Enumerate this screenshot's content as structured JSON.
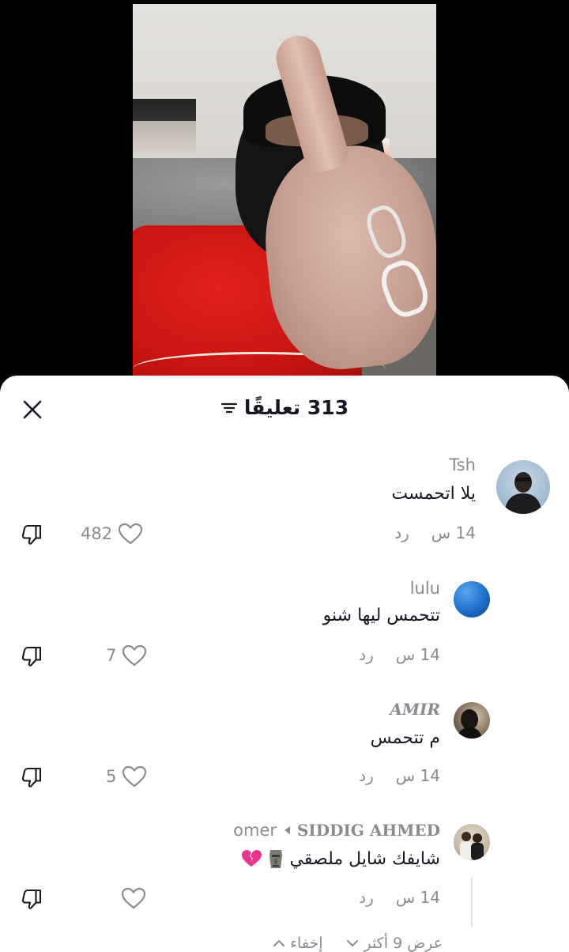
{
  "header": {
    "comment_count_label": "313 تعليقًا"
  },
  "comments": [
    {
      "username": "Tsh",
      "text": "يلا اتحمست",
      "time": "14 س",
      "reply_label": "رد",
      "likes": "482"
    },
    {
      "username": "lulu",
      "text": "تتحمس ليها شنو",
      "time": "14 س",
      "reply_label": "رد",
      "likes": "7"
    },
    {
      "username": "AMIR",
      "text": "م تتحمس",
      "time": "14 س",
      "reply_label": "رد",
      "likes": "5"
    },
    {
      "username": "SIDDIG AHMED",
      "reply_to": "omer",
      "text": "شايفك شايل ملصقي",
      "time": "14 س",
      "reply_label": "رد",
      "likes": ""
    }
  ],
  "replies_bar": {
    "view_more_label": "عرض 9 أكثر",
    "hide_label": "إخفاء"
  },
  "colors": {
    "sheet_bg": "#ffffff",
    "text_primary": "#161823",
    "text_secondary": "#8a8b91",
    "broken_heart": "#e8368f"
  },
  "icons": [
    "close-icon",
    "filter-icon",
    "heart-icon",
    "dislike-icon",
    "chevron-down-icon",
    "chevron-up-icon",
    "moai-emoji",
    "broken-heart-emoji"
  ]
}
